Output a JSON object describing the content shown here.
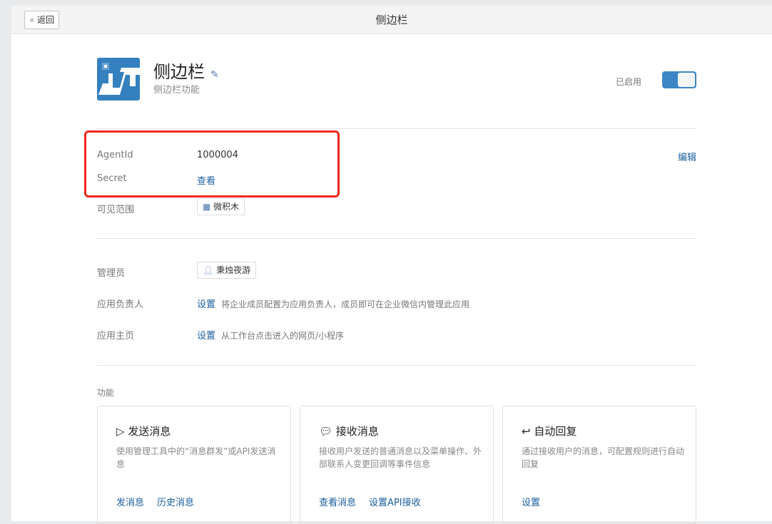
{
  "header": {
    "back_label": "返回",
    "title": "侧边栏"
  },
  "app": {
    "name": "侧边栏",
    "description": "侧边栏功能",
    "status_label": "已启用",
    "enabled": true
  },
  "credentials": {
    "agentid_label": "AgentId",
    "agentid_value": "1000004",
    "secret_label": "Secret",
    "secret_link": "查看",
    "edit_link": "编辑"
  },
  "visibility": {
    "label": "可见范围",
    "value": "微积木"
  },
  "admin": {
    "label": "管理员",
    "value": "秉烛夜游"
  },
  "owner": {
    "label": "应用负责人",
    "link": "设置",
    "hint": "将企业成员配置为应用负责人，成员即可在企业微信内管理此应用"
  },
  "homepage": {
    "label": "应用主页",
    "link": "设置",
    "hint": "从工作台点击进入的网页/小程序"
  },
  "features": {
    "label": "功能",
    "cards": [
      {
        "title": "发送消息",
        "desc": "使用管理工具中的“消息群发”或API发送消息",
        "links": [
          "发消息",
          "历史消息"
        ]
      },
      {
        "title": "接收消息",
        "desc": "接收用户发送的普通消息以及菜单操作、外部联系人变更回调等事件信息",
        "links": [
          "查看消息",
          "设置API接收"
        ]
      },
      {
        "title": "自动回复",
        "desc": "通过接收用户的消息，可配置规则进行自动回复",
        "links": [
          "设置"
        ]
      }
    ]
  }
}
